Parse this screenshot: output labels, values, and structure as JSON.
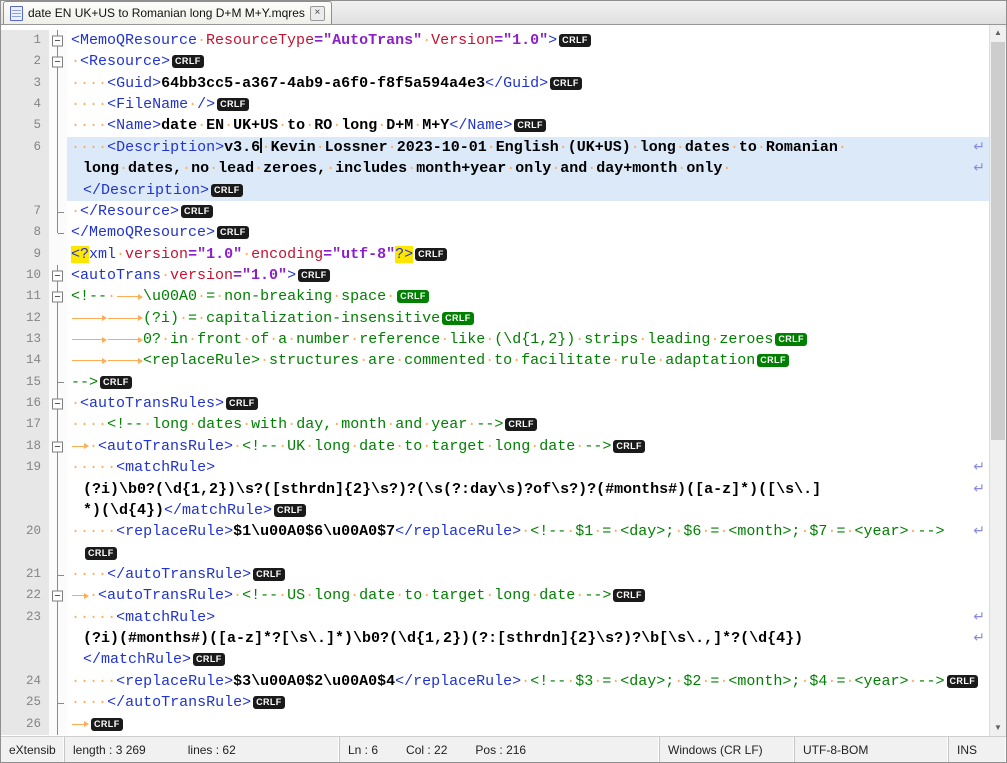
{
  "tab": {
    "title": "date EN UK+US to Romanian long D+M M+Y.mqres",
    "close_glyph": "×"
  },
  "colors": {
    "tag": "#2133cc",
    "attribute": "#c41230",
    "attribute_value": "#8b1fc8",
    "comment": "#008000",
    "content_text": "#000000",
    "whitespace": "#ffac59",
    "selection": "#dbe9f9",
    "eol_badge": "#1a1a1a",
    "eol_badge_comment": "#008000",
    "match_highlight": "#ffe600"
  },
  "scrollbar": {
    "up_glyph": "▲",
    "down_glyph": "▼"
  },
  "status": {
    "doc_type": "eXtensib",
    "length_text": "length : 3 269",
    "lines_text": "lines : 62",
    "ln": "Ln : 6",
    "col": "Col : 22",
    "pos": "Pos : 216",
    "eol": "Windows (CR LF)",
    "encoding": "UTF-8-BOM",
    "mode": "INS"
  },
  "editor": {
    "eol_label": "CRLF",
    "wrap_glyph": "↵",
    "rows": [
      {
        "n": "1",
        "f": "m",
        "sg": [
          [
            "t",
            "<MemoQResource "
          ],
          [
            "a",
            "ResourceType"
          ],
          [
            "v",
            "=\"AutoTrans\""
          ],
          [
            "t",
            " "
          ],
          [
            "a",
            "Version"
          ],
          [
            "v",
            "=\"1.0\""
          ],
          [
            "t",
            ">"
          ],
          [
            "e"
          ]
        ]
      },
      {
        "n": "2",
        "f": "m",
        "sg": [
          [
            "t",
            " <Resource>"
          ],
          [
            "e"
          ]
        ]
      },
      {
        "n": "3",
        "f": "v",
        "sg": [
          [
            "t",
            "    <Guid>"
          ],
          [
            "b",
            "64bb3cc5-a367-4ab9-a6f0-f8f5a594a4e3"
          ],
          [
            "t",
            "</Guid>"
          ],
          [
            "e"
          ]
        ]
      },
      {
        "n": "4",
        "f": "v",
        "sg": [
          [
            "t",
            "    <FileName />"
          ],
          [
            "e"
          ]
        ]
      },
      {
        "n": "5",
        "f": "v",
        "sg": [
          [
            "t",
            "    <Name>"
          ],
          [
            "b",
            "date EN UK+US to RO long D+M M+Y"
          ],
          [
            "t",
            "</Name>"
          ],
          [
            "e"
          ]
        ]
      },
      {
        "n": "6",
        "f": "v",
        "s": 1,
        "sg": [
          [
            "t",
            "    <Description>"
          ],
          [
            "b",
            "v3.6"
          ],
          [
            "cr"
          ],
          [
            "b",
            " Kevin Lossner 2023-10-01 English (UK+US) long dates to Romanian "
          ],
          [
            "w"
          ]
        ]
      },
      {
        "n": "",
        "f": "v",
        "s": 1,
        "i": 1,
        "sg": [
          [
            "b",
            "long dates, no lead zeroes, includes month+year only and day+month only "
          ],
          [
            "w"
          ]
        ]
      },
      {
        "n": "",
        "f": "v",
        "s": 1,
        "i": 1,
        "sg": [
          [
            "t",
            "</Description>"
          ],
          [
            "e"
          ]
        ]
      },
      {
        "n": "7",
        "f": "t",
        "sg": [
          [
            "t",
            " </Resource>"
          ],
          [
            "e"
          ]
        ]
      },
      {
        "n": "8",
        "f": "c",
        "sg": [
          [
            "t",
            "</MemoQResource>"
          ],
          [
            "e"
          ]
        ]
      },
      {
        "n": "9",
        "f": "",
        "sg": [
          [
            "y",
            "<?"
          ],
          [
            "t",
            "xml "
          ],
          [
            "a",
            "version"
          ],
          [
            "v",
            "=\"1.0\""
          ],
          [
            "t",
            " "
          ],
          [
            "a",
            "encoding"
          ],
          [
            "v",
            "=\"utf-8\""
          ],
          [
            "y",
            "?>"
          ],
          [
            "e"
          ]
        ]
      },
      {
        "n": "10",
        "f": "m",
        "sg": [
          [
            "t",
            "<autoTrans "
          ],
          [
            "a",
            "version"
          ],
          [
            "v",
            "=\"1.0\""
          ],
          [
            "t",
            ">"
          ],
          [
            "e"
          ]
        ]
      },
      {
        "n": "11",
        "f": "m",
        "sg": [
          [
            "c",
            "<!-- "
          ],
          [
            "tb",
            "3"
          ],
          [
            "c",
            "\\u00A0 = non-breaking space "
          ],
          [
            "ge"
          ]
        ]
      },
      {
        "n": "12",
        "f": "v",
        "sg": [
          [
            "tb",
            "4"
          ],
          [
            "tb",
            "4"
          ],
          [
            "c",
            "(?i) = capitalization-insensitive"
          ],
          [
            "ge"
          ]
        ]
      },
      {
        "n": "13",
        "f": "v",
        "sg": [
          [
            "tb",
            "4"
          ],
          [
            "tb",
            "4"
          ],
          [
            "c",
            "0? in front of a number reference like (\\d{1,2}) strips leading zeroes"
          ],
          [
            "ge"
          ]
        ]
      },
      {
        "n": "14",
        "f": "v",
        "sg": [
          [
            "tb",
            "4"
          ],
          [
            "tb",
            "4"
          ],
          [
            "c",
            "<replaceRule> structures are commented to facilitate rule adaptation"
          ],
          [
            "ge"
          ]
        ]
      },
      {
        "n": "15",
        "f": "t",
        "sg": [
          [
            "c",
            "-->"
          ],
          [
            "e"
          ]
        ]
      },
      {
        "n": "16",
        "f": "m",
        "sg": [
          [
            "t",
            " <autoTransRules>"
          ],
          [
            "e"
          ]
        ]
      },
      {
        "n": "17",
        "f": "v",
        "sg": [
          [
            "c",
            "    <!-- long dates with day, month and year -->"
          ],
          [
            "e"
          ]
        ]
      },
      {
        "n": "18",
        "f": "m",
        "sg": [
          [
            "tb",
            "2"
          ],
          [
            "t",
            " <autoTransRule>"
          ],
          [
            "c",
            " <!-- UK long date to target long date -->"
          ],
          [
            "e"
          ]
        ]
      },
      {
        "n": "19",
        "f": "v",
        "sg": [
          [
            "t",
            "     <matchRule>"
          ],
          [
            "w"
          ]
        ]
      },
      {
        "n": "",
        "f": "v",
        "i": 1,
        "sg": [
          [
            "b",
            "(?i)\\b0?(\\d{1,2})\\s?([sthrdn]{2}\\s?)?(\\s(?:day\\s)?of\\s?)?(#months#)([a-z]*)([\\s\\.]"
          ],
          [
            "w"
          ]
        ]
      },
      {
        "n": "",
        "f": "v",
        "i": 1,
        "sg": [
          [
            "b",
            "*)(\\d{4})"
          ],
          [
            "t",
            "</matchRule>"
          ],
          [
            "e"
          ]
        ]
      },
      {
        "n": "20",
        "f": "v",
        "sg": [
          [
            "t",
            "     <replaceRule>"
          ],
          [
            "b",
            "$1\\u00A0$6\\u00A0$7"
          ],
          [
            "t",
            "</replaceRule>"
          ],
          [
            "c",
            " <!-- $1 = <day>; $6 = <month>; $7 = <year> -->"
          ],
          [
            "w"
          ]
        ]
      },
      {
        "n": "",
        "f": "v",
        "i": 1,
        "sg": [
          [
            "e"
          ]
        ]
      },
      {
        "n": "21",
        "f": "t",
        "sg": [
          [
            "t",
            "    </autoTransRule>"
          ],
          [
            "e"
          ]
        ]
      },
      {
        "n": "22",
        "f": "m",
        "sg": [
          [
            "tb",
            "2"
          ],
          [
            "t",
            " <autoTransRule>"
          ],
          [
            "c",
            " <!-- US long date to target long date -->"
          ],
          [
            "e"
          ]
        ]
      },
      {
        "n": "23",
        "f": "v",
        "sg": [
          [
            "t",
            "     <matchRule>"
          ],
          [
            "w"
          ]
        ]
      },
      {
        "n": "",
        "f": "v",
        "i": 1,
        "sg": [
          [
            "b",
            "(?i)(#months#)([a-z]*?[\\s\\.]*)\\b0?(\\d{1,2})(?:[sthrdn]{2}\\s?)?\\b[\\s\\.,]*?(\\d{4})"
          ],
          [
            "w"
          ]
        ]
      },
      {
        "n": "",
        "f": "v",
        "i": 1,
        "sg": [
          [
            "t",
            "</matchRule>"
          ],
          [
            "e"
          ]
        ]
      },
      {
        "n": "24",
        "f": "v",
        "sg": [
          [
            "t",
            "     <replaceRule>"
          ],
          [
            "b",
            "$3\\u00A0$2\\u00A0$4"
          ],
          [
            "t",
            "</replaceRule>"
          ],
          [
            "c",
            " <!-- $3 = <day>; $2 = <month>; $4 = <year> -->"
          ],
          [
            "e"
          ]
        ]
      },
      {
        "n": "25",
        "f": "t",
        "sg": [
          [
            "t",
            "    </autoTransRule>"
          ],
          [
            "e"
          ]
        ]
      },
      {
        "n": "26",
        "f": "v",
        "sg": [
          [
            "tb",
            "2"
          ],
          [
            "e"
          ]
        ]
      }
    ]
  }
}
